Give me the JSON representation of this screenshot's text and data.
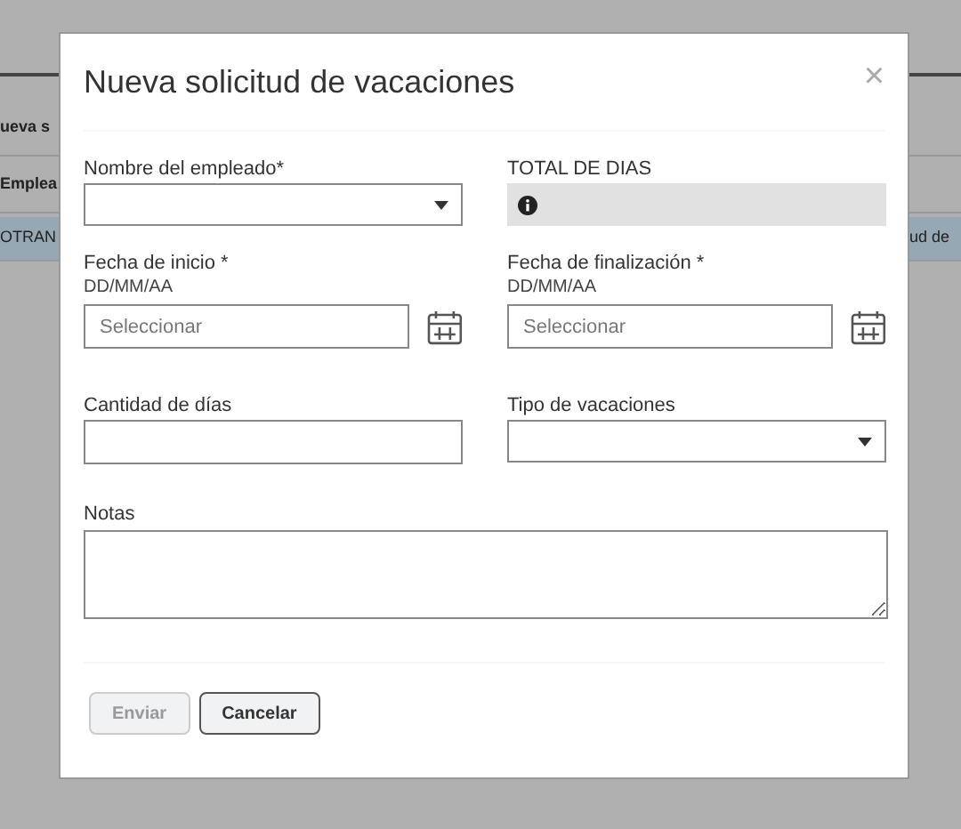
{
  "background": {
    "left_rows": [
      {
        "text": "ueva s",
        "kind": "header"
      },
      {
        "text": "Emplea",
        "kind": "header"
      },
      {
        "text": "OTRAN",
        "kind": "highlight"
      }
    ],
    "right_rows": [
      {
        "kind": "header"
      },
      {
        "kind": "header"
      },
      {
        "text": "ud de",
        "kind": "highlight"
      }
    ]
  },
  "dialog": {
    "title": "Nueva solicitud de vacaciones",
    "close": "×",
    "fields": [
      {
        "kind": "select",
        "label": "Nombre del empleado*"
      },
      {
        "kind": "info",
        "label": "TOTAL DE DIAS"
      },
      {
        "kind": "date",
        "label": "Fecha de inicio *",
        "hint": "DD/MM/AA",
        "placeholder": "Seleccionar"
      },
      {
        "kind": "date",
        "label": "Fecha de finalización *",
        "hint": "DD/MM/AA",
        "placeholder": "Seleccionar"
      },
      {
        "kind": "text",
        "label": "Cantidad de días"
      },
      {
        "kind": "select",
        "label": "Tipo de vacaciones"
      },
      {
        "kind": "textarea",
        "label": "Notas"
      }
    ],
    "buttons": [
      {
        "label": "Enviar",
        "disabled": true
      },
      {
        "label": "Cancelar",
        "disabled": false
      }
    ]
  }
}
